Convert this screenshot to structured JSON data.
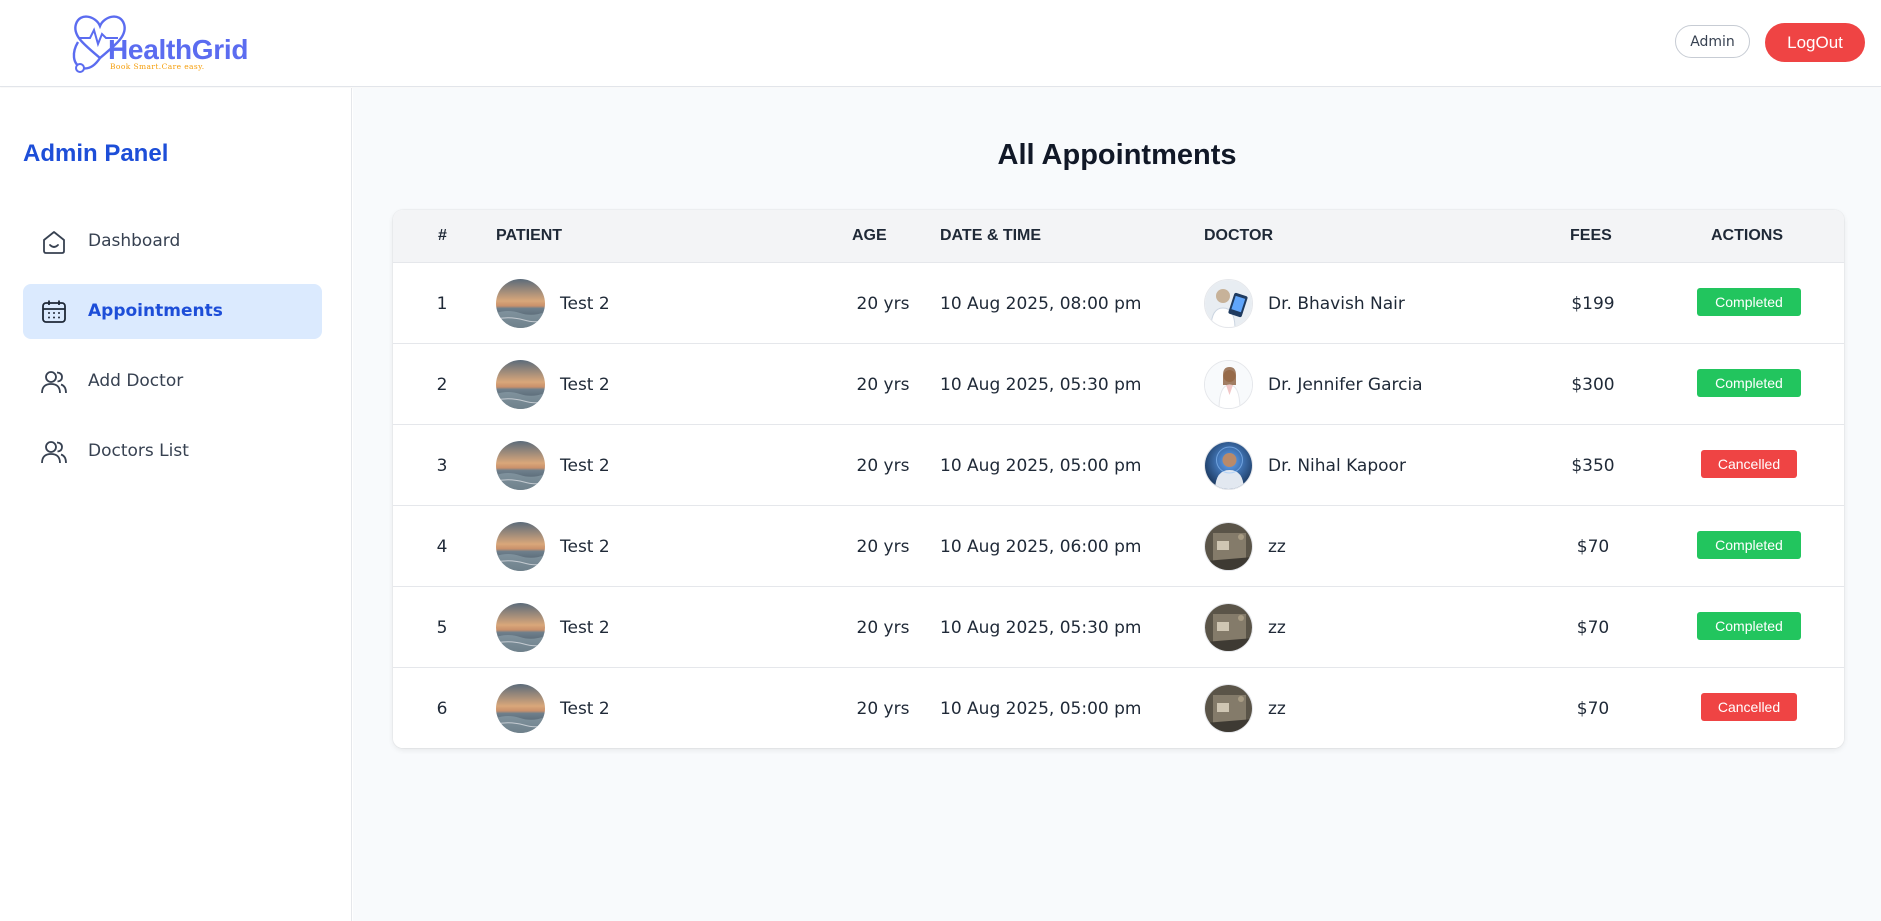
{
  "header": {
    "brand_name": "HealthGrid",
    "brand_tagline": "Book Smart.Care easy.",
    "role_label": "Admin",
    "logout_label": "LogOut"
  },
  "sidebar": {
    "title": "Admin Panel",
    "items": [
      {
        "label": "Dashboard",
        "icon": "home-icon",
        "active": false
      },
      {
        "label": "Appointments",
        "icon": "calendar-icon",
        "active": true
      },
      {
        "label": "Add Doctor",
        "icon": "users-icon",
        "active": false
      },
      {
        "label": "Doctors List",
        "icon": "users-icon",
        "active": false
      }
    ]
  },
  "main": {
    "title": "All Appointments",
    "table": {
      "headers": {
        "index": "#",
        "patient": "PATIENT",
        "age": "AGE",
        "datetime": "DATE & TIME",
        "doctor": "DOCTOR",
        "fees": "FEES",
        "actions": "ACTIONS"
      },
      "rows": [
        {
          "index": "1",
          "patient": "Test 2",
          "age": "20 yrs",
          "datetime": "10 Aug 2025, 08:00 pm",
          "doctor": "Dr. Bhavish Nair",
          "fees": "$199",
          "status": "Completed"
        },
        {
          "index": "2",
          "patient": "Test 2",
          "age": "20 yrs",
          "datetime": "10 Aug 2025, 05:30 pm",
          "doctor": "Dr. Jennifer Garcia",
          "fees": "$300",
          "status": "Completed"
        },
        {
          "index": "3",
          "patient": "Test 2",
          "age": "20 yrs",
          "datetime": "10 Aug 2025, 05:00 pm",
          "doctor": "Dr. Nihal Kapoor",
          "fees": "$350",
          "status": "Cancelled"
        },
        {
          "index": "4",
          "patient": "Test 2",
          "age": "20 yrs",
          "datetime": "10 Aug 2025, 06:00 pm",
          "doctor": "zz",
          "fees": "$70",
          "status": "Completed"
        },
        {
          "index": "5",
          "patient": "Test 2",
          "age": "20 yrs",
          "datetime": "10 Aug 2025, 05:30 pm",
          "doctor": "zz",
          "fees": "$70",
          "status": "Completed"
        },
        {
          "index": "6",
          "patient": "Test 2",
          "age": "20 yrs",
          "datetime": "10 Aug 2025, 05:00 pm",
          "doctor": "zz",
          "fees": "$70",
          "status": "Cancelled"
        }
      ]
    }
  },
  "colors": {
    "brand": "#5b6cf0",
    "accent": "#1d4ed8",
    "active_bg": "#dbeafe",
    "completed": "#22c55e",
    "cancelled": "#ef4444"
  }
}
